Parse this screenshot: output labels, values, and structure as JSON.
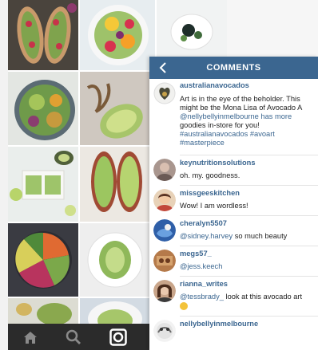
{
  "comments_panel": {
    "title": "COMMENTS",
    "comments": [
      {
        "username": "australianavocados",
        "lines": [
          "Art is in the eye of the beholder. This",
          "might be the Mona Lisa of Avocado A",
          "@nellybellyinmelbourne has more",
          "goodies in-store for you!",
          "#australianavocados #avoart",
          "#masterpiece"
        ]
      },
      {
        "username": "keynutritionsolutions",
        "text": "oh. my. goodness."
      },
      {
        "username": "missgeeskitchen",
        "text": "Wow! I am wordless!"
      },
      {
        "username": "cheralyn5507",
        "mention": "@sidney.harvey",
        "text": " so much beauty"
      },
      {
        "username": "megs57_",
        "mention": "@jess.keech",
        "text": ""
      },
      {
        "username": "rianna_writes",
        "mention": "@tessbrady_",
        "text": " look at this avocado art"
      },
      {
        "username": "nellybellyinmelbourne",
        "text": ""
      }
    ]
  },
  "bottom_nav": {
    "icons": [
      "home-icon",
      "search-icon",
      "camera-icon"
    ]
  },
  "colors": {
    "header": "#3b6690",
    "username": "#3b6690",
    "bottom_bar": "#2b2b2b"
  }
}
